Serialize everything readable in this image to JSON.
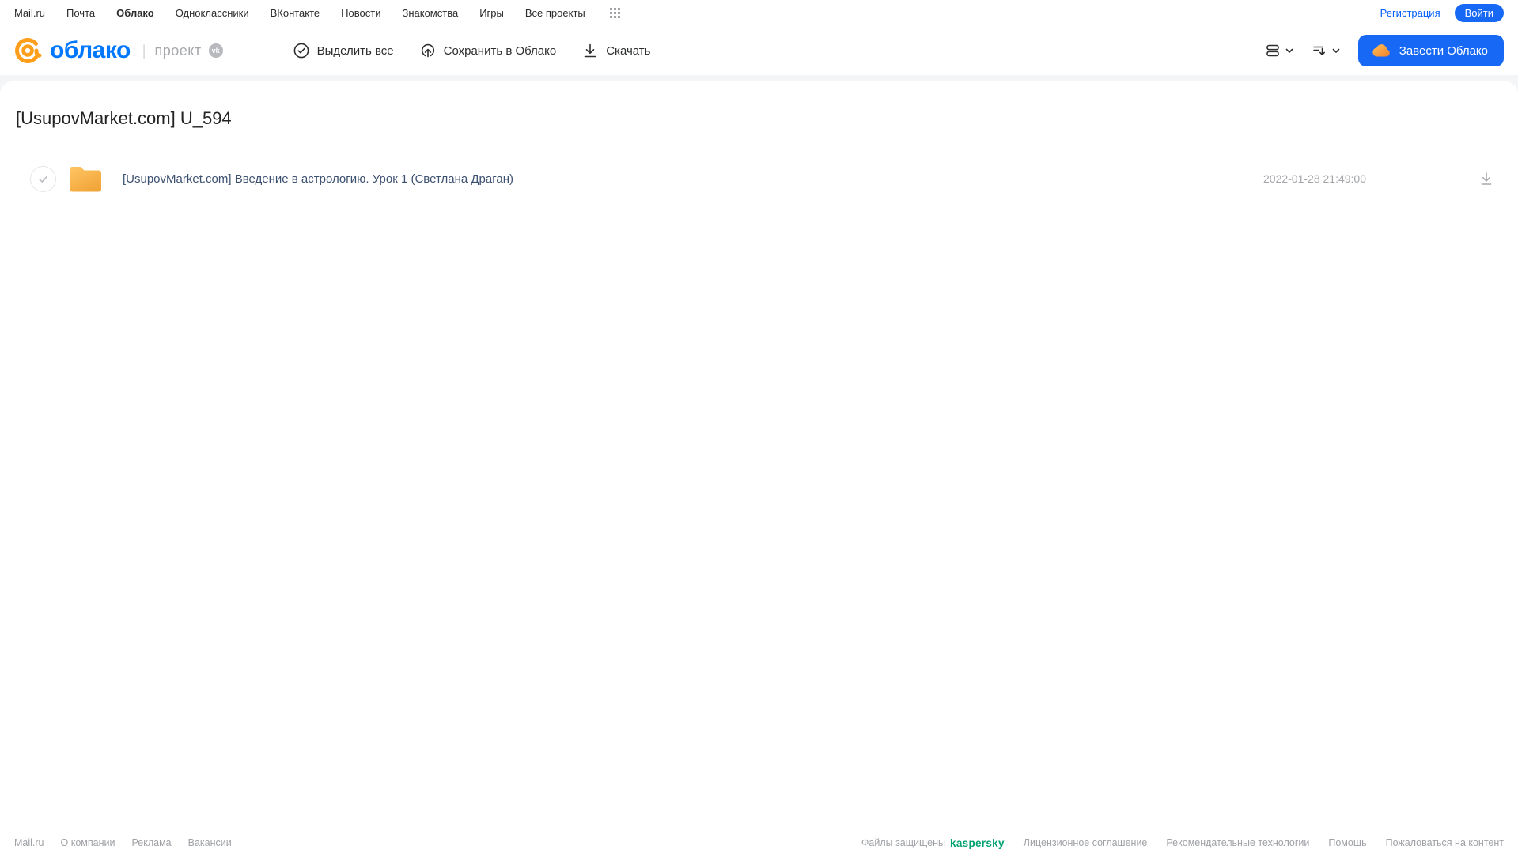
{
  "topnav": {
    "links": [
      "Mail.ru",
      "Почта",
      "Облако",
      "Одноклассники",
      "ВКонтакте",
      "Новости",
      "Знакомства",
      "Игры",
      "Все проекты"
    ],
    "registration": "Регистрация",
    "login": "Войти"
  },
  "header": {
    "logo_text": "облако",
    "logo_sep": "|",
    "project_label": "проект",
    "vk_badge": "vk",
    "toolbar": {
      "select_all": "Выделить все",
      "save_to_cloud": "Сохранить в Облако",
      "download": "Скачать"
    },
    "create_cloud_button": "Завести Облако"
  },
  "main": {
    "title": "[UsupovMarket.com] U_594",
    "files": [
      {
        "name": "[UsupovMarket.com] Введение в астрологию. Урок 1 (Светлана Драган)",
        "date": "2022-01-28 21:49:00",
        "type": "folder"
      }
    ]
  },
  "footer": {
    "left_links": [
      "Mail.ru",
      "О компании",
      "Реклама",
      "Вакансии"
    ],
    "protected_label": "Файлы защищены",
    "kaspersky_logo": "kaspersky",
    "right_links": [
      "Лицензионное соглашение",
      "Рекомендательные технологии",
      "Помощь",
      "Пожаловаться на контент"
    ]
  },
  "colors": {
    "accent_blue": "#1668f5",
    "logo_blue": "#0077ff",
    "logo_orange": "#ff9e1b",
    "kaspersky_green": "#00a170",
    "folder_top": "#ffc664",
    "folder_bottom": "#f2a63a"
  }
}
